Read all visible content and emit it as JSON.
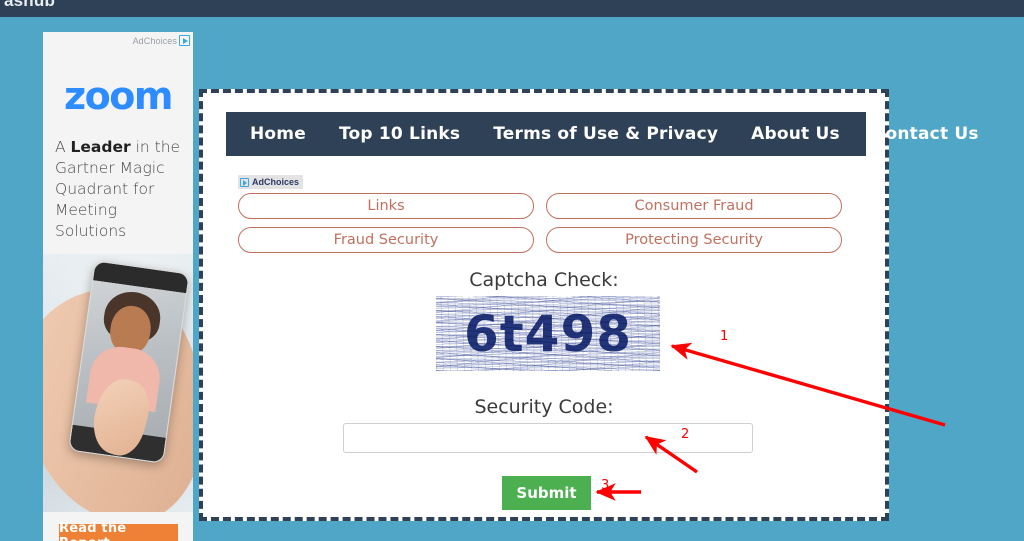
{
  "browser": {
    "tab_title_fragment": "ashub"
  },
  "theme": {
    "page_background": "#4fa6c6",
    "navbar_background": "#2f4156",
    "card_border": "#2f4156",
    "pill_border": "#c1705f",
    "pill_text": "#c1705f",
    "submit_background": "#4caf50",
    "captcha_text_color": "#23357a",
    "annotation_color": "#ff0000",
    "ad_cta_background": "#ef8136",
    "zoom_logo_color": "#2d8cff"
  },
  "ad": {
    "adchoices_label": "AdChoices",
    "adchoices_icon": "adchoices-triangle-icon",
    "brand": "zoom",
    "headline_prefix": "A ",
    "headline_bold": "Leader",
    "headline_suffix": " in the Gartner Magic Quadrant for Meeting Solutions",
    "cta_label": "Read the Report",
    "image_alt": "hand-holding-phone-video-call-photo"
  },
  "nav": {
    "items": [
      {
        "label": "Home"
      },
      {
        "label": "Top 10 Links"
      },
      {
        "label": "Terms of Use & Privacy"
      },
      {
        "label": "About Us"
      },
      {
        "label": "Contact Us"
      }
    ]
  },
  "content": {
    "adchoices_label": "AdChoices",
    "pills": [
      {
        "label": "Links"
      },
      {
        "label": "Consumer Fraud"
      },
      {
        "label": "Fraud Security"
      },
      {
        "label": "Protecting Security"
      }
    ],
    "captcha_label": "Captcha Check:",
    "captcha_value": "6t498",
    "security_code_label": "Security Code:",
    "security_code_value": "",
    "security_code_placeholder": "",
    "submit_label": "Submit"
  },
  "annotations": [
    {
      "number": "1",
      "target": "captcha-image"
    },
    {
      "number": "2",
      "target": "security-code-input"
    },
    {
      "number": "3",
      "target": "submit-button"
    }
  ]
}
